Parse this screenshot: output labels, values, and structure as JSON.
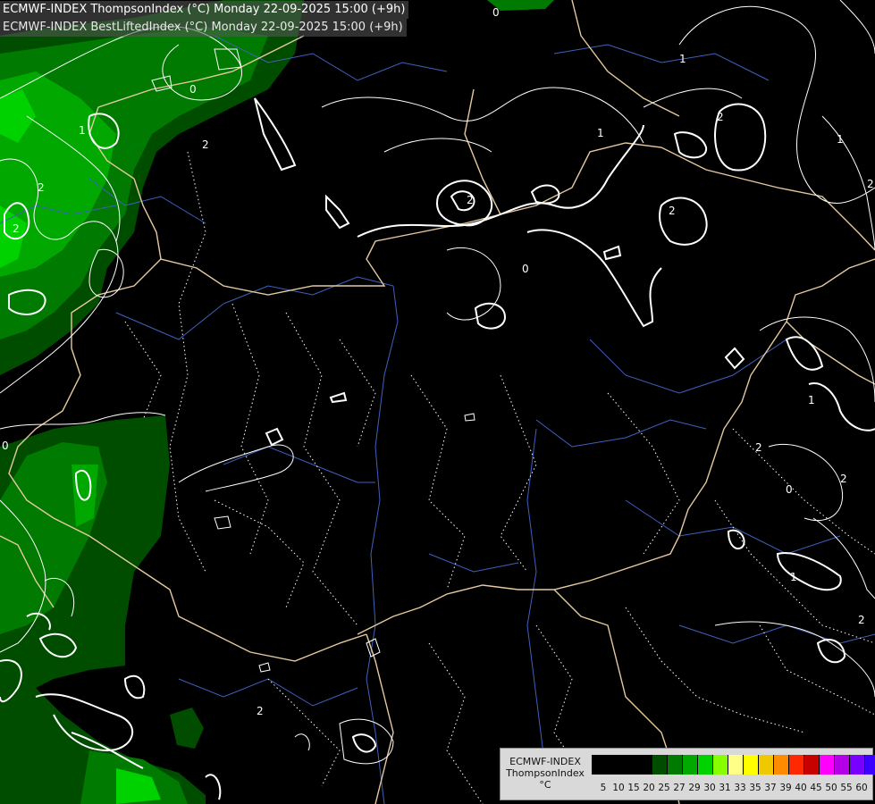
{
  "header": {
    "line1": "ECMWF-INDEX ThompsonIndex (°C) Monday 22-09-2025 15:00 (+9h)",
    "line2": "ECMWF-INDEX BestLiftedIndex (°C) Monday 22-09-2025 15:00 (+9h)"
  },
  "legend": {
    "title_line1": "ECMWF-INDEX",
    "title_line2": "ThompsonIndex",
    "title_line3": "°C",
    "swatch_colors": [
      "#000000",
      "#000000",
      "#000000",
      "#000000",
      "#004d00",
      "#007a00",
      "#00a800",
      "#00d200",
      "#88ff00",
      "#ffff88",
      "#ffff00",
      "#f0c800",
      "#ff8c00",
      "#ff2800",
      "#c80000",
      "#ff00ff",
      "#b400e6",
      "#7800ff",
      "#3c00ff",
      "#0000ff"
    ],
    "ticks": [
      "5",
      "10",
      "15",
      "20",
      "25",
      "27",
      "29",
      "30",
      "31",
      "33",
      "35",
      "37",
      "39",
      "40",
      "45",
      "50",
      "55",
      "60"
    ]
  },
  "map": {
    "contour_labels": [
      "0",
      "0",
      "2",
      "1",
      "2",
      "2",
      "2",
      "2",
      "1",
      "1",
      "2",
      "0",
      "2",
      "1",
      "1",
      "0",
      "2",
      "2",
      "2",
      "0",
      "1",
      "2"
    ],
    "colors": {
      "fill_dark": "#004d00",
      "fill_mid": "#007a00",
      "fill_light": "#00a800",
      "fill_bright": "#00d200",
      "border": "#e6c9a0",
      "river": "#4060c0",
      "contour": "#ffffff"
    }
  }
}
